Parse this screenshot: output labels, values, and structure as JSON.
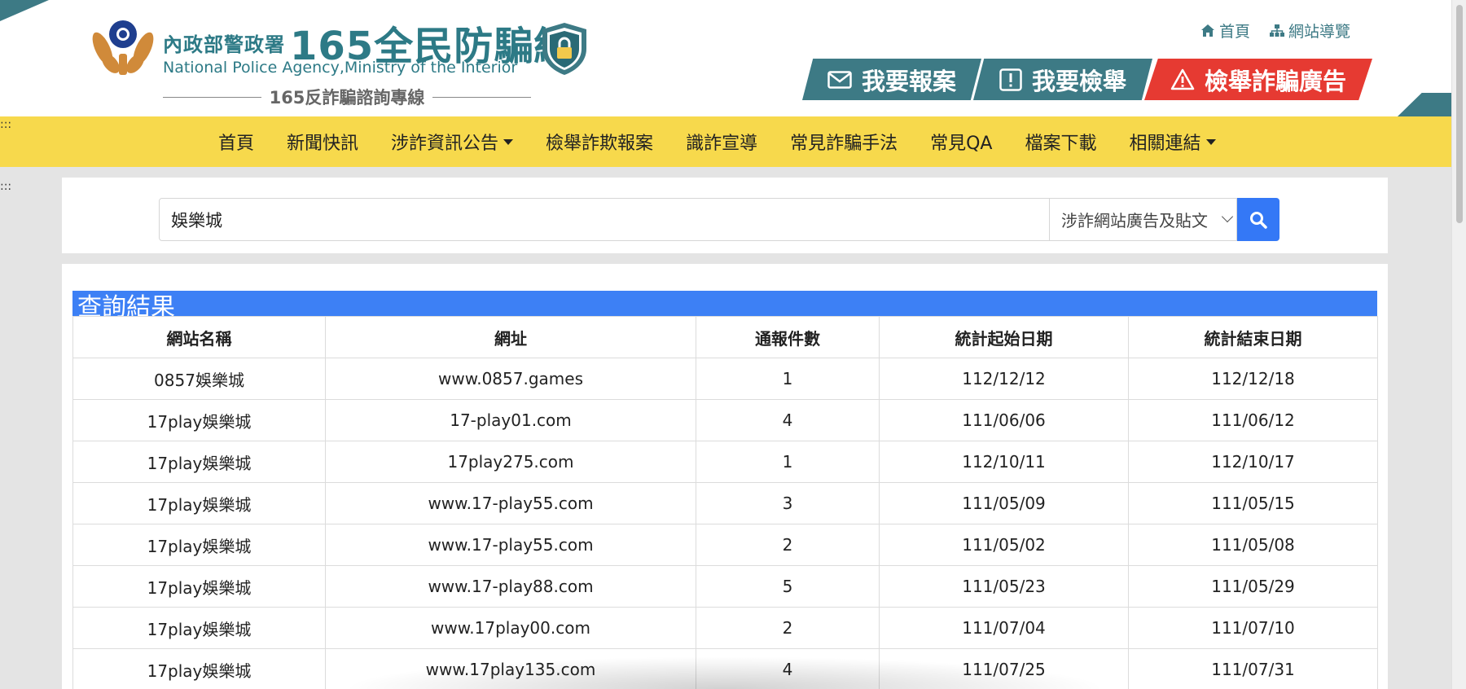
{
  "header": {
    "agency_cn": "內政部警政署",
    "site_name": "165全民防騙網",
    "agency_en": "National Police Agency,Ministry of the Interior",
    "hotline": "165反詐騙諮詢專線",
    "top_links": [
      {
        "label": "首頁",
        "icon": "home-icon"
      },
      {
        "label": "網站導覽",
        "icon": "sitemap-icon"
      }
    ],
    "actions": [
      {
        "label": "我要報案",
        "icon": "envelope-icon"
      },
      {
        "label": "我要檢舉",
        "icon": "exclamation-icon"
      },
      {
        "label": "檢舉詐騙廣告",
        "icon": "warning-icon"
      }
    ]
  },
  "accesskeys": [
    ":::",
    ":::"
  ],
  "nav": {
    "items": [
      {
        "label": "首頁"
      },
      {
        "label": "新聞快訊"
      },
      {
        "label": "涉詐資訊公告",
        "dropdown": true
      },
      {
        "label": "檢舉詐欺報案"
      },
      {
        "label": "識詐宣導"
      },
      {
        "label": "常見詐騙手法"
      },
      {
        "label": "常見QA"
      },
      {
        "label": "檔案下載"
      },
      {
        "label": "相關連結",
        "dropdown": true
      }
    ]
  },
  "search": {
    "value": "娛樂城",
    "category": "涉詐網站廣告及貼文",
    "button_icon": "search-icon"
  },
  "results": {
    "title": "查詢結果",
    "columns": [
      "網站名稱",
      "網址",
      "通報件數",
      "統計起始日期",
      "統計結束日期"
    ],
    "rows": [
      [
        "0857娛樂城",
        "www.0857.games",
        "1",
        "112/12/12",
        "112/12/18"
      ],
      [
        "17play娛樂城",
        "17-play01.com",
        "4",
        "111/06/06",
        "111/06/12"
      ],
      [
        "17play娛樂城",
        "17play275.com",
        "1",
        "112/10/11",
        "112/10/17"
      ],
      [
        "17play娛樂城",
        "www.17-play55.com",
        "3",
        "111/05/09",
        "111/05/15"
      ],
      [
        "17play娛樂城",
        "www.17-play55.com",
        "2",
        "111/05/02",
        "111/05/08"
      ],
      [
        "17play娛樂城",
        "www.17-play88.com",
        "5",
        "111/05/23",
        "111/05/29"
      ],
      [
        "17play娛樂城",
        "www.17play00.com",
        "2",
        "111/07/04",
        "111/07/10"
      ],
      [
        "17play娛樂城",
        "www.17play135.com",
        "4",
        "111/07/25",
        "111/07/31"
      ]
    ]
  },
  "colors": {
    "brand_teal": "#3d7a85",
    "nav_yellow": "#f7d94c",
    "alert_red": "#e63a32",
    "accent_blue": "#3478f6"
  }
}
